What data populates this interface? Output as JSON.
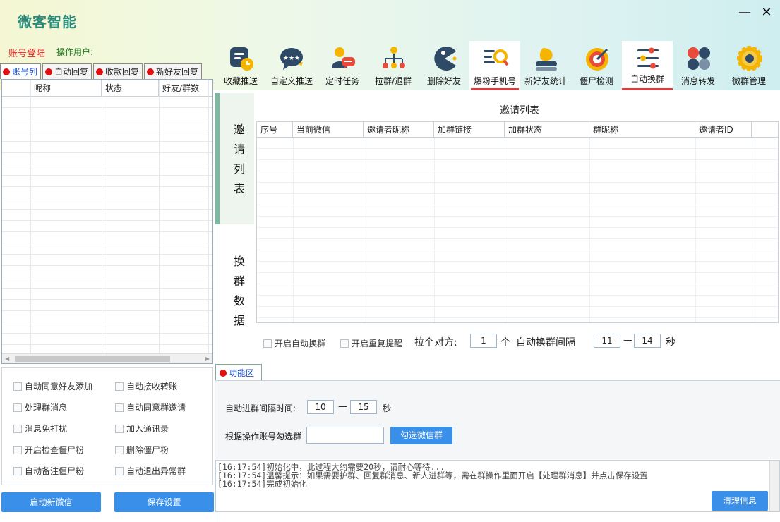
{
  "app": {
    "title": "微客智能",
    "minimize": "—",
    "close": "✕"
  },
  "account": {
    "login_label": "账号登陆",
    "operator_label": "操作用户:"
  },
  "toolbar": [
    {
      "label": "收藏推送",
      "icon": "bookmark-clock-icon"
    },
    {
      "label": "自定义推送",
      "icon": "chat-stars-icon"
    },
    {
      "label": "定时任务",
      "icon": "user-chat-icon"
    },
    {
      "label": "拉群/退群",
      "icon": "org-chart-icon"
    },
    {
      "label": "删除好友",
      "icon": "pacman-icon"
    },
    {
      "label": "爆粉手机号",
      "icon": "list-search-icon"
    },
    {
      "label": "新好友统计",
      "icon": "user-stack-icon"
    },
    {
      "label": "僵尸检测",
      "icon": "target-icon"
    },
    {
      "label": "自动换群",
      "icon": "sliders-icon"
    },
    {
      "label": "消息转发",
      "icon": "dots-grid-icon"
    },
    {
      "label": "微群管理",
      "icon": "gear-icon"
    }
  ],
  "active_tool": "自动换群",
  "left_tabs": [
    "账号列",
    "自动回复",
    "收款回复",
    "新好友回复"
  ],
  "account_table": {
    "columns": [
      "",
      "昵称",
      "状态",
      "好友/群数"
    ]
  },
  "options": [
    "自动同意好友添加",
    "自动接收转账",
    "处理群消息",
    "自动同意群邀请",
    "消息免打扰",
    "加入通讯录",
    "开启检查僵尸粉",
    "删除僵尸粉",
    "自动备注僵尸粉",
    "自动退出异常群"
  ],
  "buttons": {
    "start_wechat": "启动新微信",
    "save_settings": "保存设置",
    "select_groups": "勾选微信群",
    "clear_info": "清理信息"
  },
  "side_labels": {
    "invite": [
      "邀",
      "请",
      "列",
      "表"
    ],
    "switch": [
      "换",
      "群",
      "数",
      "据"
    ]
  },
  "invite_list": {
    "title": "邀请列表",
    "columns": [
      "序号",
      "当前微信",
      "邀请者昵称",
      "加群链接",
      "加群状态",
      "群昵称",
      "邀请者ID"
    ]
  },
  "switch_controls": {
    "auto_switch": "开启自动换群",
    "repeat_reminder": "开启重复提醒",
    "pull_label": "拉个对方:",
    "pull_value": "1",
    "pull_unit": "个",
    "interval_label": "自动换群间隔",
    "interval_min": "11",
    "interval_sep": "—",
    "interval_max": "14",
    "interval_unit": "秒"
  },
  "function_area": {
    "tab": "功能区",
    "join_interval_label": "自动进群间隔时间:",
    "join_min": "10",
    "join_sep": "—",
    "join_max": "15",
    "join_unit": "秒",
    "select_by_label": "根据操作账号勾选群",
    "select_by_value": ""
  },
  "log": [
    "[16:17:54]初始化中，此过程大约需要20秒，请耐心等待...",
    "[16:17:54]温馨提示：如果需要护群、回复群消息、新人进群等，需在群操作里面开启【处理群消息】并点击保存设置",
    "[16:17:54]完成初始化"
  ],
  "colors": {
    "accent": "#3a8fe8",
    "active_tab_underline": "#e03a3a",
    "brand": "#2a8a7a"
  }
}
